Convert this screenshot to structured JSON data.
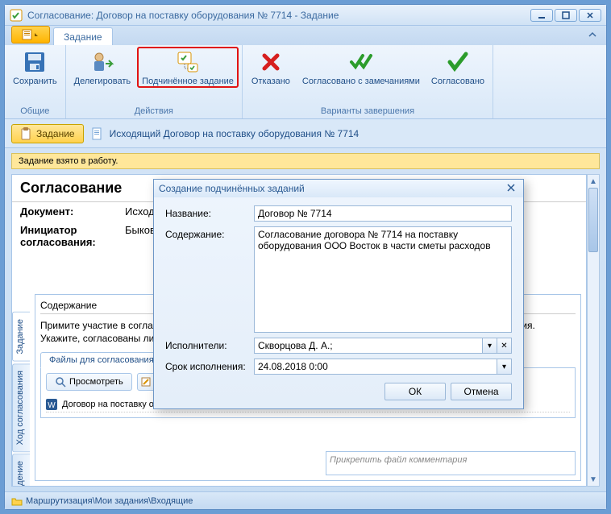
{
  "window": {
    "title": "Согласование: Договор на поставку оборудования № 7714 - Задание"
  },
  "ribbon": {
    "tab": "Задание",
    "groups": {
      "common": {
        "label": "Общие",
        "save": "Сохранить"
      },
      "actions": {
        "label": "Действия",
        "delegate": "Делегировать",
        "subtask": "Подчинённое задание"
      },
      "completion": {
        "label": "Варианты завершения",
        "refused": "Отказано",
        "agreed_notes": "Согласовано с замечаниями",
        "agreed": "Согласовано"
      }
    }
  },
  "docbar": {
    "pill": "Задание",
    "link": "Исходящий Договор на поставку оборудования № 7714"
  },
  "message": "Задание взято в работу.",
  "panel": {
    "title": "Согласование",
    "doc_label": "Документ:",
    "doc_value": "Исходящий Договор на поставку оборудования № 7714 ООО «Восток» Быков",
    "initiator_label": "Инициатор согласования:",
    "initiator_value": "Быков",
    "side_tabs": {
      "task": "Задание",
      "approval": "Ход согласования",
      "discussion": "Обсуждение"
    },
    "content_header": "Содержание",
    "content_text": "Примите участие в согласовании исходящего документа. При необходимости, зафиксируйте свои замечания. Укажите, согласованы ли исходящий документ или они требуют доработки.",
    "files_tab": "Файлы для согласования",
    "view_btn": "Просмотреть",
    "file_name": "Договор на поставку оборудования ООО Восток.docx",
    "comment_placeholder": "Прикрепить файл комментария"
  },
  "statusbar": {
    "path": "Маршрутизация\\Мои задания\\Входящие"
  },
  "dialog": {
    "title": "Создание подчинённых заданий",
    "name_label": "Название:",
    "name_value": "Договор № 7714",
    "content_label": "Содержание:",
    "content_value": "Согласование договора № 7714 на поставку оборудования ООО Восток в части сметы расходов",
    "executors_label": "Исполнители:",
    "executors_value": "Скворцова Д. А.;",
    "deadline_label": "Срок исполнения:",
    "deadline_value": "24.08.2018 0:00",
    "ok": "ОК",
    "cancel": "Отмена"
  }
}
